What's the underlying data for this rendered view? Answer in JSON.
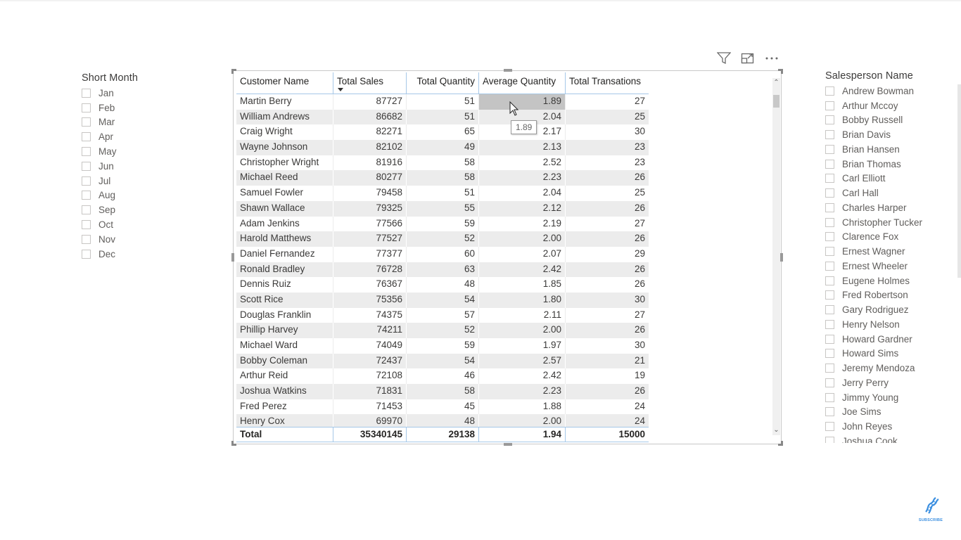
{
  "month_slicer": {
    "title": "Short Month",
    "items": [
      "Jan",
      "Feb",
      "Mar",
      "Apr",
      "May",
      "Jun",
      "Jul",
      "Aug",
      "Sep",
      "Oct",
      "Nov",
      "Dec"
    ]
  },
  "salesperson_slicer": {
    "title": "Salesperson Name",
    "items": [
      "Andrew Bowman",
      "Arthur Mccoy",
      "Bobby Russell",
      "Brian Davis",
      "Brian Hansen",
      "Brian Thomas",
      "Carl Elliott",
      "Carl Hall",
      "Charles Harper",
      "Christopher Tucker",
      "Clarence Fox",
      "Ernest Wagner",
      "Ernest Wheeler",
      "Eugene Holmes",
      "Fred Robertson",
      "Gary Rodriguez",
      "Henry Nelson",
      "Howard Gardner",
      "Howard Sims",
      "Jeremy Mendoza",
      "Jerry Perry",
      "Jimmy Young",
      "Joe Sims",
      "John Reyes",
      "Joshua Cook"
    ]
  },
  "visual_header": {
    "icons": [
      "filter-icon",
      "focus-mode-icon",
      "more-options-icon"
    ]
  },
  "table": {
    "columns": [
      "Customer Name",
      "Total Sales",
      "Total Quantity",
      "Average Quantity",
      "Total Transations"
    ],
    "sorted_column": "Total Sales",
    "sort_direction": "descending",
    "rows": [
      [
        "Martin Berry",
        "87727",
        "51",
        "1.89",
        "27"
      ],
      [
        "William Andrews",
        "86682",
        "51",
        "2.04",
        "25"
      ],
      [
        "Craig Wright",
        "82271",
        "65",
        "2.17",
        "30"
      ],
      [
        "Wayne Johnson",
        "82102",
        "49",
        "2.13",
        "23"
      ],
      [
        "Christopher Wright",
        "81916",
        "58",
        "2.52",
        "23"
      ],
      [
        "Michael Reed",
        "80277",
        "58",
        "2.23",
        "26"
      ],
      [
        "Samuel Fowler",
        "79458",
        "51",
        "2.04",
        "25"
      ],
      [
        "Shawn Wallace",
        "79325",
        "55",
        "2.12",
        "26"
      ],
      [
        "Adam Jenkins",
        "77566",
        "59",
        "2.19",
        "27"
      ],
      [
        "Harold Matthews",
        "77527",
        "52",
        "2.00",
        "26"
      ],
      [
        "Daniel Fernandez",
        "77377",
        "60",
        "2.07",
        "29"
      ],
      [
        "Ronald Bradley",
        "76728",
        "63",
        "2.42",
        "26"
      ],
      [
        "Dennis Ruiz",
        "76367",
        "48",
        "1.85",
        "26"
      ],
      [
        "Scott Rice",
        "75356",
        "54",
        "1.80",
        "30"
      ],
      [
        "Douglas Franklin",
        "74375",
        "57",
        "2.11",
        "27"
      ],
      [
        "Phillip Harvey",
        "74211",
        "52",
        "2.00",
        "26"
      ],
      [
        "Michael Ward",
        "74049",
        "59",
        "1.97",
        "30"
      ],
      [
        "Bobby Coleman",
        "72437",
        "54",
        "2.57",
        "21"
      ],
      [
        "Arthur Reid",
        "72108",
        "46",
        "2.42",
        "19"
      ],
      [
        "Joshua Watkins",
        "71831",
        "58",
        "2.23",
        "26"
      ],
      [
        "Fred Perez",
        "71453",
        "45",
        "1.88",
        "24"
      ],
      [
        "Henry Cox",
        "69970",
        "48",
        "2.00",
        "24"
      ]
    ],
    "total": [
      "Total",
      "35340145",
      "29138",
      "1.94",
      "15000"
    ],
    "selected_cell": {
      "row": 0,
      "column": "Average Quantity"
    },
    "tooltip": "1.89"
  },
  "branding": {
    "subscribe_label": "SUBSCRIBE",
    "accent_color": "#3b8fe0"
  }
}
